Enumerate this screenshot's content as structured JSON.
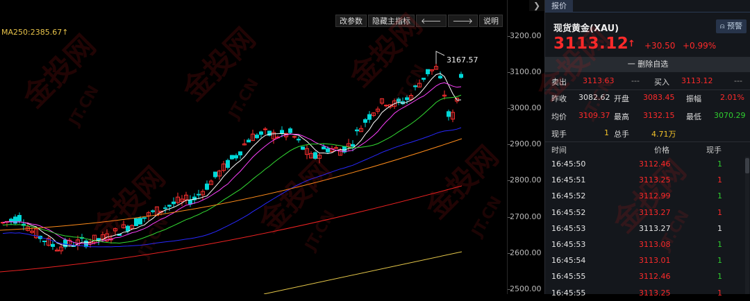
{
  "toolbar": {
    "params_label": "改参数",
    "hide_indicator_label": "隐藏主指标",
    "left_arrow": "🡐",
    "right_arrow": "🡒",
    "help_label": "说明",
    "collapse_icon": "❯"
  },
  "indicator": {
    "ma250_label": "MA250:2385.67↑"
  },
  "chart": {
    "high_label": "3167.57",
    "axis_ticks": [
      "3200.00",
      "3100.00",
      "3000.00",
      "2900.00",
      "2800.00",
      "2700.00",
      "2600.00",
      "2500.00"
    ],
    "colors": {
      "up": "#ff3030",
      "down": "#00d8d8",
      "ma_white": "#ffffff",
      "ma_magenta": "#ff40ff",
      "ma_green": "#33dd33",
      "ma_blue": "#2828ff",
      "ma_orange": "#ff8c1a",
      "ma_red": "#ee2222",
      "ma250": "#e6c84a"
    }
  },
  "panel": {
    "tab": "报价",
    "symbol": "现货黄金(XAU)",
    "alert_label": "预警",
    "price": "3113.12",
    "price_arrow": "↑",
    "change": "+30.50",
    "change_pct": "+0.99%",
    "remove_fav": "一 删除自选",
    "bid_label": "卖出",
    "bid": "3113.63",
    "bid_vol": "---",
    "ask_label": "买入",
    "ask": "3113.12",
    "ask_vol": "---",
    "prev_close_label": "昨收",
    "prev_close": "3082.62",
    "open_label": "开盘",
    "open": "3083.45",
    "amplitude_label": "振幅",
    "amplitude": "2.01%",
    "avg_label": "均价",
    "avg": "3109.37",
    "high_label": "最高",
    "high": "3132.15",
    "low_label": "最低",
    "low": "3070.29",
    "cur_vol_label": "现手",
    "cur_vol": "1",
    "total_vol_label": "总手",
    "total_vol": "4.71万"
  },
  "ticks": {
    "headers": {
      "time": "时间",
      "price": "价格",
      "vol": "现手"
    },
    "rows": [
      {
        "time": "16:45:50",
        "price": "3112.46",
        "vol": "1",
        "dir": "green"
      },
      {
        "time": "16:45:51",
        "price": "3113.25",
        "vol": "1",
        "dir": "red"
      },
      {
        "time": "16:45:52",
        "price": "3112.99",
        "vol": "1",
        "dir": "green"
      },
      {
        "time": "16:45:52",
        "price": "3113.27",
        "vol": "1",
        "dir": "red"
      },
      {
        "time": "16:45:53",
        "price": "3113.27",
        "vol": "1",
        "dir": "white"
      },
      {
        "time": "16:45:53",
        "price": "3113.08",
        "vol": "1",
        "dir": "green"
      },
      {
        "time": "16:45:54",
        "price": "3113.01",
        "vol": "1",
        "dir": "green"
      },
      {
        "time": "16:45:55",
        "price": "3112.46",
        "vol": "1",
        "dir": "green"
      },
      {
        "time": "16:45:55",
        "price": "3113.25",
        "vol": "1",
        "dir": "red"
      }
    ]
  },
  "watermark": {
    "logo_text": "金投网",
    "domain_text": "JT.CN"
  }
}
